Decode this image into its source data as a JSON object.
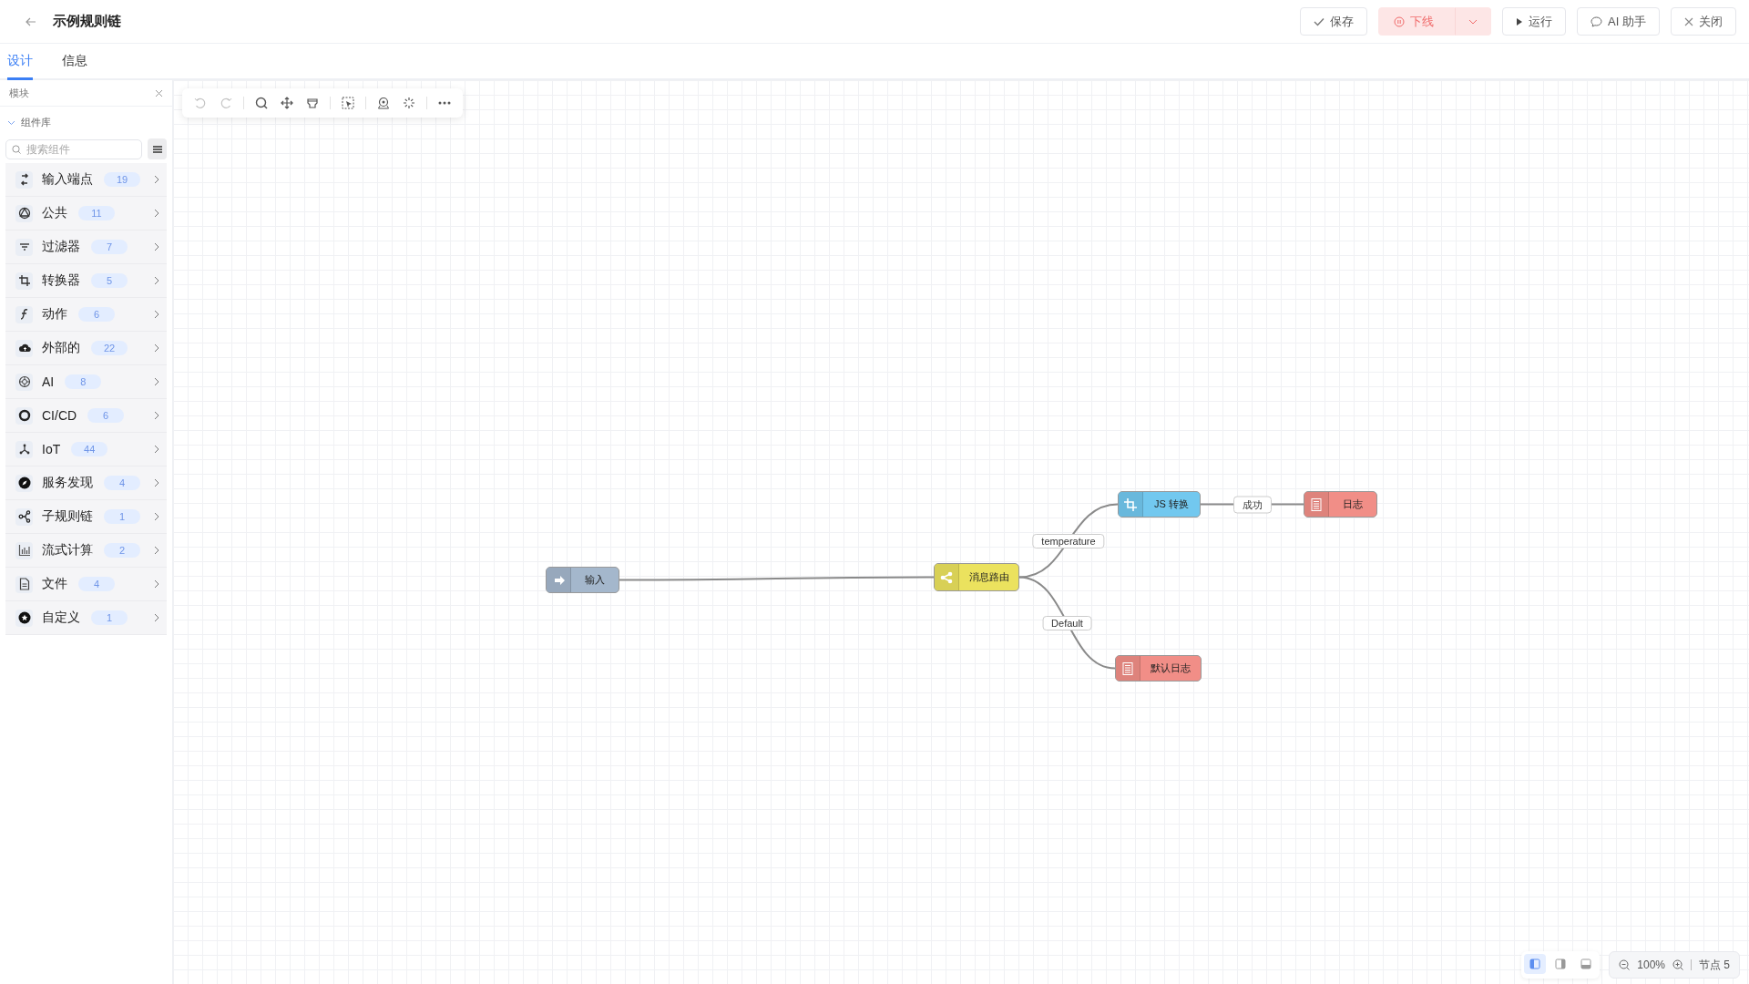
{
  "header": {
    "title": "示例规则链",
    "buttons": [
      {
        "kind": "save",
        "label": "保存"
      },
      {
        "kind": "offline",
        "label": "下线"
      },
      {
        "kind": "run",
        "label": "运行"
      },
      {
        "kind": "ai",
        "label": "AI 助手"
      },
      {
        "kind": "close",
        "label": "关闭"
      }
    ]
  },
  "tabs": [
    {
      "label": "设计",
      "selected": true
    },
    {
      "label": "信息",
      "selected": false
    }
  ],
  "sidebar": {
    "title": "模块",
    "section": {
      "label": "组件库",
      "expanded": true
    },
    "search": {
      "placeholder": "搜索组件"
    },
    "categories": [
      {
        "label": "输入端点",
        "count": "19"
      },
      {
        "label": "公共",
        "count": "11"
      },
      {
        "label": "过滤器",
        "count": "7"
      },
      {
        "label": "转换器",
        "count": "5"
      },
      {
        "label": "动作",
        "count": "6"
      },
      {
        "label": "外部的",
        "count": "22"
      },
      {
        "label": "AI",
        "count": "8"
      },
      {
        "label": "CI/CD",
        "count": "6"
      },
      {
        "label": "IoT",
        "count": "44"
      },
      {
        "label": "服务发现",
        "count": "4"
      },
      {
        "label": "子规则链",
        "count": "1"
      },
      {
        "label": "流式计算",
        "count": "2"
      },
      {
        "label": "文件",
        "count": "4"
      },
      {
        "label": "自定义",
        "count": "1"
      }
    ]
  },
  "toolbar": [
    {
      "disabled": true
    },
    {
      "disabled": true
    },
    {
      "disabled": false
    },
    {
      "disabled": false
    },
    {
      "disabled": false
    },
    {
      "disabled": false
    },
    {
      "disabled": false
    },
    {
      "disabled": false
    },
    {
      "disabled": false
    }
  ],
  "nodes": [
    {
      "kind": "input",
      "label": "输入",
      "color": "#a4b7cc"
    },
    {
      "kind": "router",
      "label": "消息路由",
      "color": "#ebe25e"
    },
    {
      "kind": "transform",
      "label": "JS 转换",
      "color": "#72c8ef"
    },
    {
      "kind": "log",
      "label": "日志",
      "color": "#f18e87"
    },
    {
      "kind": "log",
      "label": "默认日志",
      "color": "#f18e87"
    }
  ],
  "edges": [
    {
      "kind": "plain"
    },
    {
      "kind": "labeled",
      "label": "temperature"
    },
    {
      "kind": "labeled",
      "label": "成功"
    },
    {
      "kind": "labeled",
      "label": "Default"
    }
  ],
  "footer": {
    "views": [
      {
        "selected": true
      },
      {
        "selected": false
      },
      {
        "selected": false
      }
    ],
    "zoom": "100%",
    "node_count": "节点 5"
  }
}
